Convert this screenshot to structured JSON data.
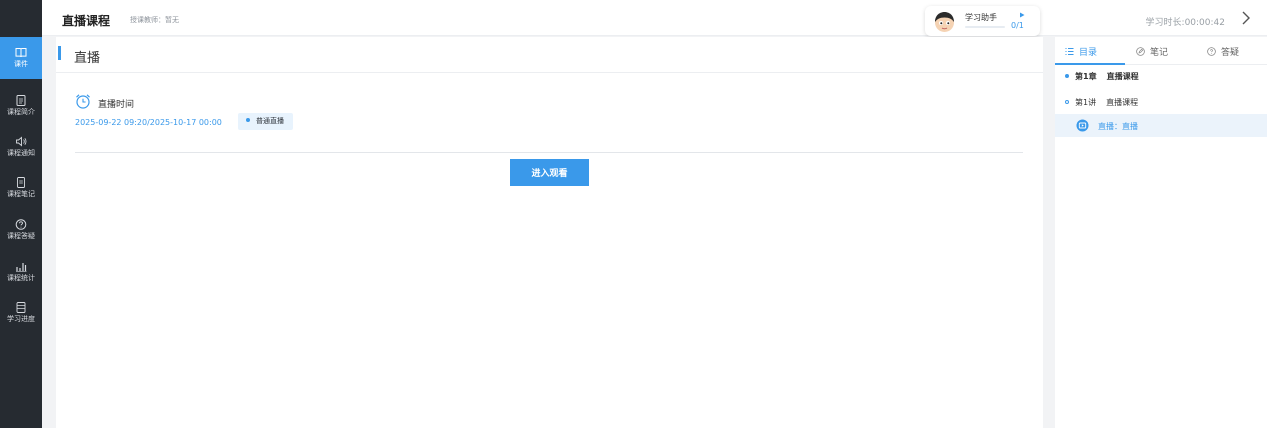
{
  "header": {
    "course_title": "直播课程",
    "teacher": "授课教师：暂无",
    "study_time": "学习时长:00:00:42"
  },
  "assistant": {
    "label": "学习助手",
    "count": "0/1",
    "progress": 0
  },
  "sidebar": {
    "items": [
      {
        "label": "课件",
        "icon": "book-icon",
        "active": true
      },
      {
        "label": "课程简介",
        "icon": "document-icon",
        "active": false
      },
      {
        "label": "课程通知",
        "icon": "speaker-icon",
        "active": false
      },
      {
        "label": "课程笔记",
        "icon": "note-icon",
        "active": false
      },
      {
        "label": "课程答疑",
        "icon": "question-icon",
        "active": false
      },
      {
        "label": "课程统计",
        "icon": "bar-chart-icon",
        "active": false
      },
      {
        "label": "学习进度",
        "icon": "progress-icon",
        "active": false
      }
    ]
  },
  "main": {
    "section_title": "直播",
    "live_time_label": "直播时间",
    "live_range": "2025-09-22 09:20/2025-10-17 00:00",
    "live_tag": "普通直播",
    "enter_button": "进入观看"
  },
  "right_panel": {
    "tabs": [
      {
        "label": "目录",
        "icon": "list-icon",
        "active": true
      },
      {
        "label": "笔记",
        "icon": "edit-icon",
        "active": false
      },
      {
        "label": "答疑",
        "icon": "question-icon",
        "active": false
      }
    ],
    "chapter": {
      "number": "第1章",
      "title": "直播课程"
    },
    "lecture": {
      "number": "第1讲",
      "title": "直播课程"
    },
    "lesson": "直播：直播"
  },
  "colors": {
    "accent": "#3a99ea",
    "sidebar_bg": "#262b31",
    "page_bg": "#f2f3f5"
  }
}
